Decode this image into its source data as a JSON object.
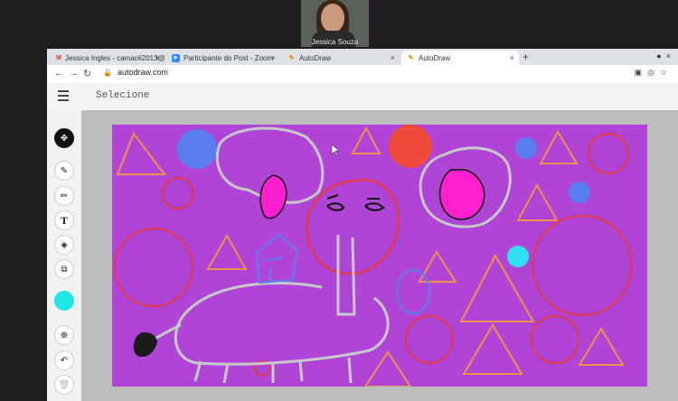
{
  "video": {
    "participant_name": "Jessica Souza"
  },
  "tabs": [
    {
      "label": "Jessica Ingles - camaoli2013@g...",
      "favicon": "gmail-icon",
      "active": false
    },
    {
      "label": "Participante do Post - Zoom",
      "favicon": "zoom-icon",
      "active": false
    },
    {
      "label": "AutoDraw",
      "favicon": "autodraw-icon",
      "active": false
    },
    {
      "label": "AutoDraw",
      "favicon": "autodraw-icon",
      "active": true
    }
  ],
  "addressbar": {
    "url": "autodraw.com"
  },
  "app": {
    "mode_label": "Selecione"
  },
  "toolbar": {
    "tools": [
      "move-tool",
      "autodraw-tool",
      "draw-tool",
      "type-tool",
      "fill-tool",
      "shape-tool",
      "color-picker",
      "zoom-tool",
      "undo-tool",
      "delete-tool"
    ],
    "selected_color": "#20e6e6"
  },
  "canvas": {
    "background_color": "#b044d6"
  }
}
